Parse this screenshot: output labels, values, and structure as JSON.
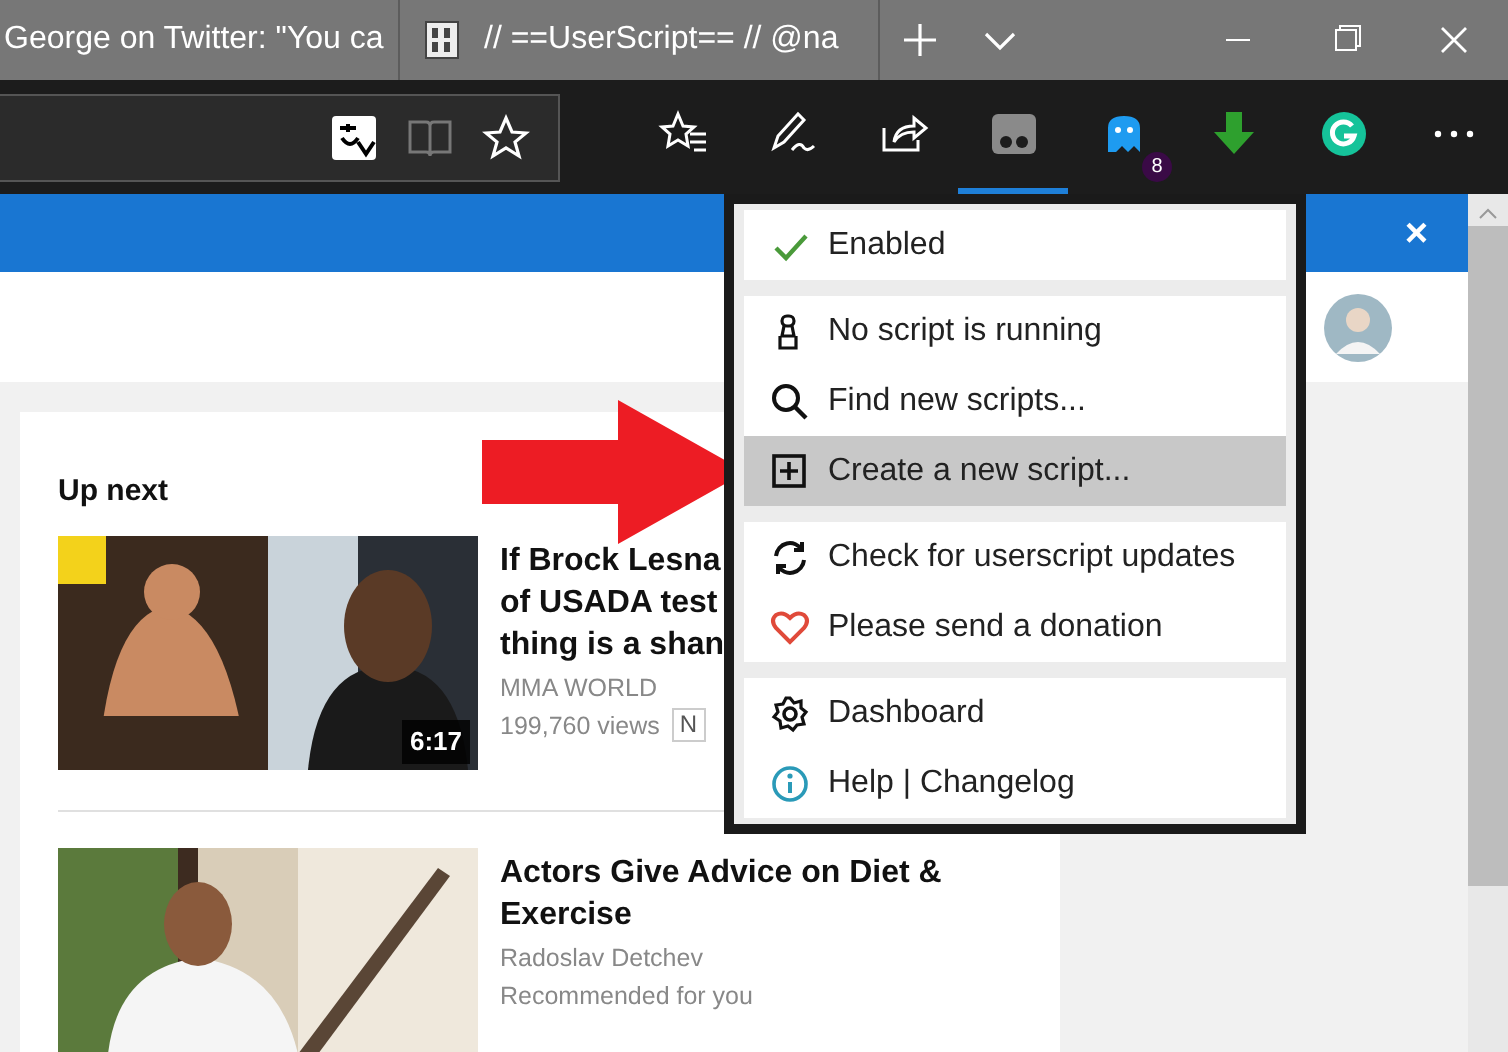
{
  "tabs": [
    {
      "label": "George on Twitter: \"You ca",
      "selected": false
    },
    {
      "label": "// ==UserScript== // @na",
      "selected": false
    }
  ],
  "toolbar": {
    "buttons": [
      {
        "selected": false
      },
      {
        "selected": false
      },
      {
        "selected": false
      },
      {
        "selected": true
      },
      {
        "selected": false,
        "badge": "8"
      },
      {
        "selected": false
      },
      {
        "selected": false
      },
      {
        "selected": false
      }
    ]
  },
  "banner": {
    "close": "×"
  },
  "up_next": {
    "heading": "Up next",
    "videos": [
      {
        "title_lines": [
          "If Brock Lesna",
          "of USADA test",
          "thing is a shan"
        ],
        "channel": "MMA WORLD",
        "views": "199,760 views",
        "badge": "N",
        "duration": "6:17"
      },
      {
        "title_lines": [
          "Actors Give Advice on Diet &",
          "Exercise"
        ],
        "channel": "Radoslav Detchev",
        "views": "Recommended for you"
      }
    ]
  },
  "menu": {
    "groups": [
      [
        {
          "label": "Enabled",
          "checked": true,
          "selected": false
        }
      ],
      [
        {
          "label": "No script is running",
          "selected": false
        },
        {
          "label": "Find new scripts...",
          "selected": false
        },
        {
          "label": "Create a new script...",
          "selected": true
        }
      ],
      [
        {
          "label": "Check for userscript updates",
          "selected": false
        },
        {
          "label": "Please send a donation",
          "selected": false
        }
      ],
      [
        {
          "label": "Dashboard",
          "selected": false
        },
        {
          "label": "Help | Changelog",
          "selected": false
        }
      ]
    ]
  }
}
